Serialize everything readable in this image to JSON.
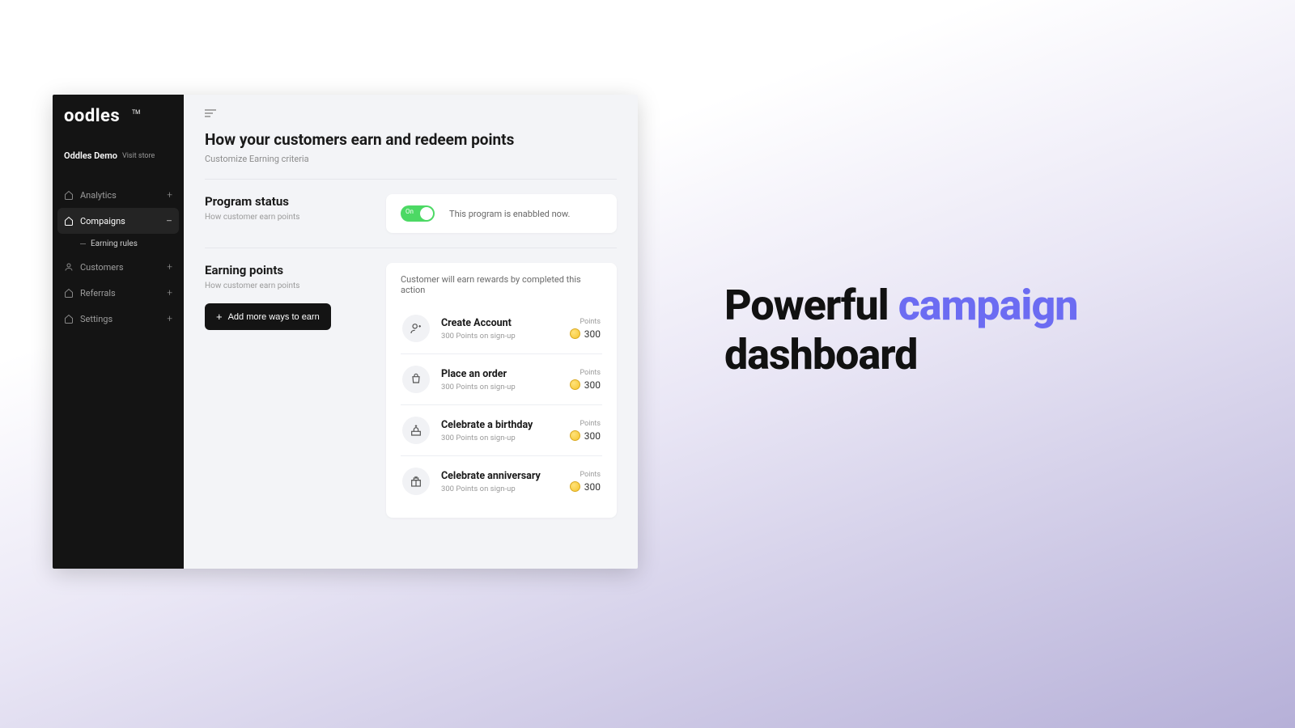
{
  "branding": {
    "logo": "oodles",
    "tm": "TM"
  },
  "store": {
    "name": "Oddles Demo",
    "visit": "Visit store"
  },
  "sidebar": {
    "items": [
      {
        "label": "Analytics",
        "icon": "home"
      },
      {
        "label": "Compaigns",
        "icon": "home"
      },
      {
        "label": "Customers",
        "icon": "user"
      },
      {
        "label": "Referrals",
        "icon": "share"
      },
      {
        "label": "Settings",
        "icon": "gear"
      }
    ],
    "sub_item": "Earning rules"
  },
  "page": {
    "title": "How your customers earn and redeem points",
    "subtitle": "Customize Earning criteria"
  },
  "status": {
    "heading": "Program status",
    "sub": "How customer earn points",
    "toggle_label": "On",
    "message": "This program is enabbled now."
  },
  "earning": {
    "heading": "Earning points",
    "sub": "How customer earn points",
    "button": "Add more ways to earn",
    "card_title": "Customer will earn rewards by completed this action",
    "points_label": "Points",
    "rules": [
      {
        "title": "Create Account",
        "sub": "300 Points on sign-up",
        "points": "300"
      },
      {
        "title": "Place an order",
        "sub": "300 Points on sign-up",
        "points": "300"
      },
      {
        "title": "Celebrate a birthday",
        "sub": "300 Points on sign-up",
        "points": "300"
      },
      {
        "title": "Celebrate anniversary",
        "sub": "300 Points on sign-up",
        "points": "300"
      }
    ]
  },
  "hero": {
    "word1": "Powerful",
    "word2": "campaign",
    "word3": "dashboard"
  }
}
